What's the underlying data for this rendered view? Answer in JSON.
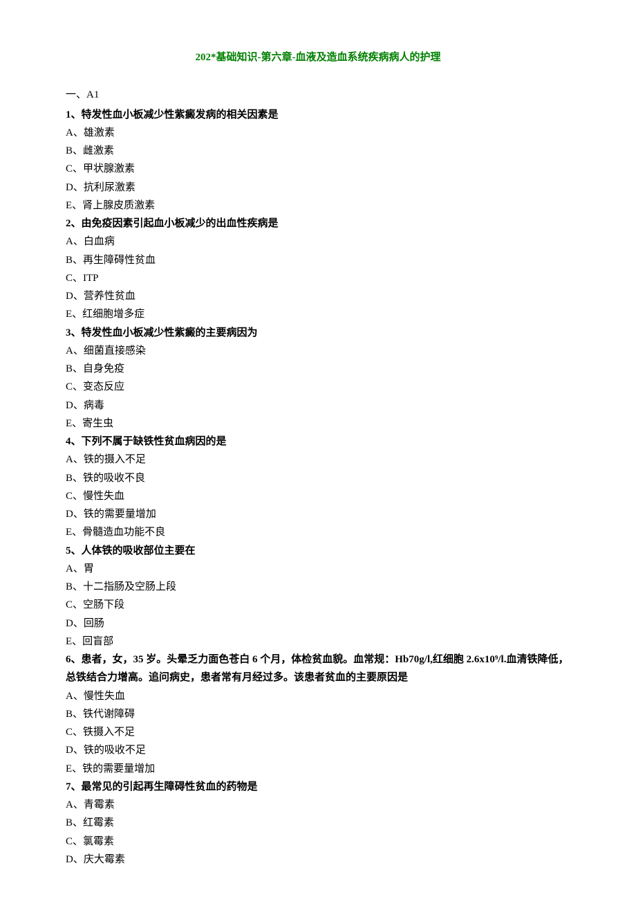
{
  "title": "202*基础知识-第六章-血液及造血系统疾病病人的护理",
  "sectionLabel": "一、A1",
  "questions": [
    {
      "num": "1、",
      "stem": "特发性血小板减少性紫癜发病的相关因素是",
      "options": [
        "A、雄激素",
        "B、雌激素",
        "C、甲状腺激素",
        "D、抗利尿激素",
        "E、肾上腺皮质激素"
      ]
    },
    {
      "num": "2、",
      "stem": "由免疫因素引起血小板减少的出血性疾病是",
      "options": [
        "A、白血病",
        "B、再生障碍性贫血",
        "C、ITP",
        "D、营养性贫血",
        "E、红细胞增多症"
      ]
    },
    {
      "num": "3、",
      "stem": "特发性血小板减少性紫癜的主要病因为",
      "options": [
        "A、细菌直接感染",
        "B、自身免疫",
        "C、变态反应",
        "D、病毒",
        "E、寄生虫"
      ]
    },
    {
      "num": "4、",
      "stem": "下列不属于缺铁性贫血病因的是",
      "options": [
        "A、铁的摄入不足",
        "B、铁的吸收不良",
        "C、慢性失血",
        "D、铁的需要量增加",
        "E、骨髓造血功能不良"
      ]
    },
    {
      "num": "5、",
      "stem": "人体铁的吸收部位主要在",
      "options": [
        "A、胃",
        "B、十二指肠及空肠上段",
        "C、空肠下段",
        "D、回肠",
        "E、回盲部"
      ]
    },
    {
      "num": "6、",
      "stem": "患者，女，35 岁。头晕乏力面色苍白 6 个月，体检贫血貌。血常规：Hb70g/l,红细胞 2.6x10⁹/l.血清铁降低，总铁结合力增高。追问病史，患者常有月经过多。该患者贫血的主要原因是",
      "options": [
        "A、慢性失血",
        "B、铁代谢障碍",
        "C、铁摄入不足",
        "D、铁的吸收不足",
        "E、铁的需要量增加"
      ]
    },
    {
      "num": "7、",
      "stem": "最常见的引起再生障碍性贫血的药物是",
      "options": [
        "A、青霉素",
        "B、红霉素",
        "C、氯霉素",
        "D、庆大霉素"
      ]
    }
  ]
}
